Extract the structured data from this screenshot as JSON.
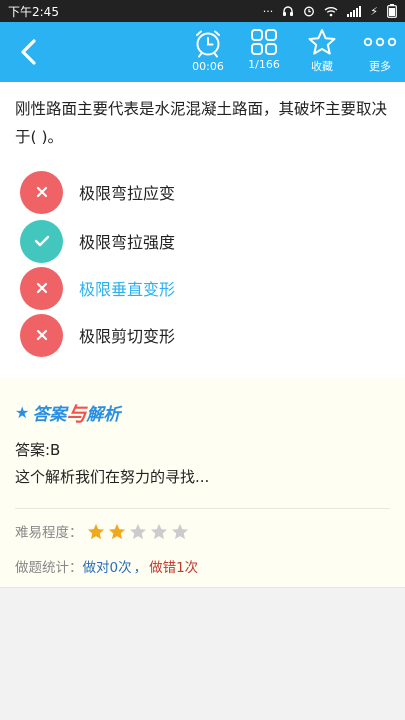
{
  "status_bar": {
    "time": "下午2:45",
    "battery": "⚡"
  },
  "toolbar": {
    "timer_label": "00:06",
    "progress_label": "1/166",
    "favorite_label": "收藏",
    "more_label": "更多"
  },
  "question": {
    "text": "刚性路面主要代表是水泥混凝土路面，其破坏主要取决于(   )。",
    "options": [
      {
        "label": "极限弯拉应变",
        "state": "wrong"
      },
      {
        "label": "极限弯拉强度",
        "state": "correct"
      },
      {
        "label": "极限垂直变形",
        "state": "wrong-selected"
      },
      {
        "label": "极限剪切变形",
        "state": "wrong"
      }
    ]
  },
  "analysis": {
    "title_a": "答案",
    "title_b": "与",
    "title_c": "解析",
    "answer": "答案:B",
    "explanation": "这个解析我们在努力的寻找...",
    "difficulty_label": "难易程度：",
    "difficulty_rating": 2,
    "difficulty_max": 5,
    "stats_label": "做题统计：",
    "stats_right": "做对0次",
    "stats_sep": "，",
    "stats_wrong": "做错1次"
  },
  "colors": {
    "toolbar": "#2ab2f2",
    "wrong": "#ef6266",
    "correct": "#43c6bd",
    "selected_text": "#2ab2f2",
    "star_on": "#f0a81c",
    "star_off": "#cccccc"
  }
}
